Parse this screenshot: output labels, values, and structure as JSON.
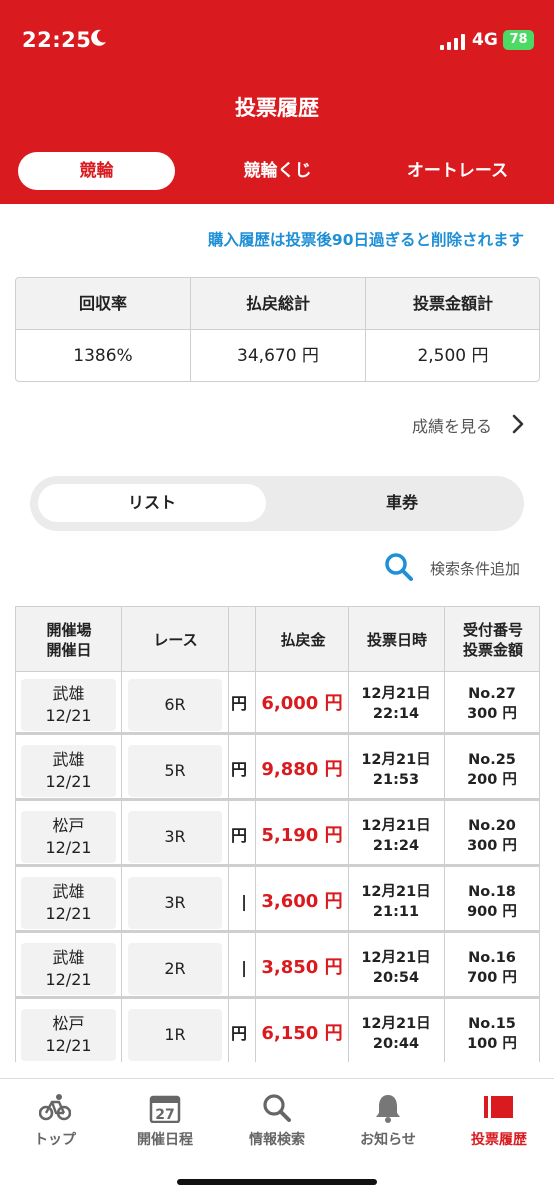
{
  "status_bar": {
    "time": "22:25",
    "network": "4G",
    "battery": "78"
  },
  "header": {
    "title": "投票履歴",
    "tabs": [
      {
        "label": "競輪",
        "active": true
      },
      {
        "label": "競輪くじ",
        "active": false
      },
      {
        "label": "オートレース",
        "active": false
      }
    ]
  },
  "notice": "購入履歴は投票後90日過ぎると削除されます",
  "summary": {
    "headers": [
      "回収率",
      "払戻総計",
      "投票金額計"
    ],
    "values": [
      "1386%",
      "34,670 円",
      "2,500 円"
    ]
  },
  "results_link": "成績を見る",
  "segment": {
    "options": [
      "リスト",
      "車券"
    ],
    "active": "リスト"
  },
  "search_add": "検索条件追加",
  "table": {
    "headers": {
      "venue": "開催場\n開催日",
      "race": "レース",
      "payout": "払戻金",
      "vote_datetime": "投票日時",
      "ticket": "受付番号\n投票金額"
    },
    "rows": [
      {
        "venue": "武雄",
        "date": "12/21",
        "race": "6R",
        "cut": "円",
        "payout": "6,000 円",
        "vote_date": "12月21日",
        "vote_time": "22:14",
        "no": "No.27",
        "amount": "300 円"
      },
      {
        "venue": "武雄",
        "date": "12/21",
        "race": "5R",
        "cut": "円",
        "payout": "9,880 円",
        "vote_date": "12月21日",
        "vote_time": "21:53",
        "no": "No.25",
        "amount": "200 円"
      },
      {
        "venue": "松戸",
        "date": "12/21",
        "race": "3R",
        "cut": "円",
        "payout": "5,190 円",
        "vote_date": "12月21日",
        "vote_time": "21:24",
        "no": "No.20",
        "amount": "300 円"
      },
      {
        "venue": "武雄",
        "date": "12/21",
        "race": "3R",
        "cut": "|",
        "payout": "3,600 円",
        "vote_date": "12月21日",
        "vote_time": "21:11",
        "no": "No.18",
        "amount": "900 円"
      },
      {
        "venue": "武雄",
        "date": "12/21",
        "race": "2R",
        "cut": "|",
        "payout": "3,850 円",
        "vote_date": "12月21日",
        "vote_time": "20:54",
        "no": "No.16",
        "amount": "700 円"
      },
      {
        "venue": "松戸",
        "date": "12/21",
        "race": "1R",
        "cut": "円",
        "payout": "6,150 円",
        "vote_date": "12月21日",
        "vote_time": "20:44",
        "no": "No.15",
        "amount": "100 円"
      }
    ]
  },
  "tabbar": [
    {
      "label": "トップ",
      "icon": "bicycle-icon",
      "active": false
    },
    {
      "label": "開催日程",
      "icon": "calendar-icon",
      "badge": "27",
      "active": false
    },
    {
      "label": "情報検索",
      "icon": "search-icon",
      "active": false
    },
    {
      "label": "お知らせ",
      "icon": "bell-icon",
      "active": false
    },
    {
      "label": "投票履歴",
      "icon": "history-icon",
      "active": true
    }
  ],
  "colors": {
    "brand": "#d91a1f",
    "notice": "#1f8fd6",
    "battery": "#4cd964"
  }
}
